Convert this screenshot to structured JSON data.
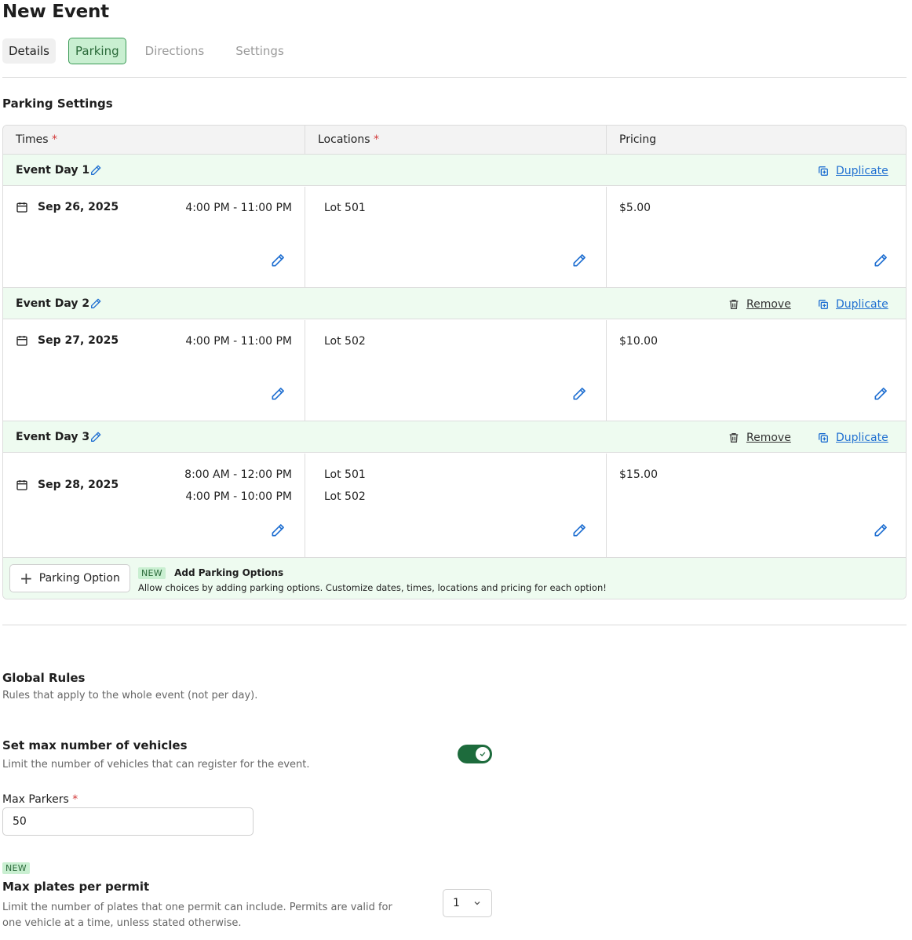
{
  "page": {
    "title": "New Event",
    "tabs": [
      {
        "label": "Details"
      },
      {
        "label": "Parking"
      },
      {
        "label": "Directions"
      },
      {
        "label": "Settings"
      }
    ]
  },
  "parking": {
    "section_title": "Parking Settings",
    "columns": {
      "times": "Times",
      "locations": "Locations",
      "pricing": "Pricing",
      "required_mark": "*"
    },
    "duplicate_label": "Duplicate",
    "remove_label": "Remove",
    "days": [
      {
        "name": "Event Day 1",
        "date": "Sep 26, 2025",
        "times": [
          "4:00 PM - 11:00 PM"
        ],
        "locations": [
          "Lot 501"
        ],
        "price": "$5.00"
      },
      {
        "name": "Event Day 2",
        "date": "Sep 27, 2025",
        "times": [
          "4:00 PM - 11:00 PM"
        ],
        "locations": [
          "Lot 502"
        ],
        "price": "$10.00"
      },
      {
        "name": "Event Day 3",
        "date": "Sep 28, 2025",
        "times": [
          "8:00 AM - 12:00 PM",
          "4:00 PM - 10:00 PM"
        ],
        "locations": [
          "Lot 501",
          "Lot 502"
        ],
        "price": "$15.00"
      }
    ],
    "add_option_label": "Parking Option",
    "promo": {
      "badge": "NEW",
      "title": "Add Parking Options",
      "description": "Allow choices by adding parking options. Customize dates, times, locations and pricing for each option!"
    }
  },
  "global_rules": {
    "title": "Global Rules",
    "subtitle": "Rules that apply to the whole event (not per day).",
    "max_vehicles": {
      "title": "Set max number of vehicles",
      "description": "Limit the number of vehicles that can register for the event.",
      "enabled": true
    },
    "max_parkers": {
      "label": "Max Parkers",
      "required_mark": "*",
      "value": "50"
    },
    "max_plates": {
      "badge": "NEW",
      "title": "Max plates per permit",
      "description": "Limit the number of plates that one permit can include. Permits are valid for one vehicle at a time, unless stated otherwise.",
      "selected": "1"
    }
  },
  "colors": {
    "accent_green": "#1d6b3c",
    "tab_active_bg": "#c9efd1",
    "row_tint": "#eefbf0",
    "link_blue": "#1f6fd1",
    "required_red": "#d23a3a"
  },
  "icons": {
    "edit": "pencil-icon",
    "calendar": "calendar-icon",
    "duplicate": "duplicate-icon",
    "remove": "trash-icon",
    "add": "plus-icon",
    "dropdown": "chevron-down-icon",
    "toggle_check": "check-icon"
  }
}
